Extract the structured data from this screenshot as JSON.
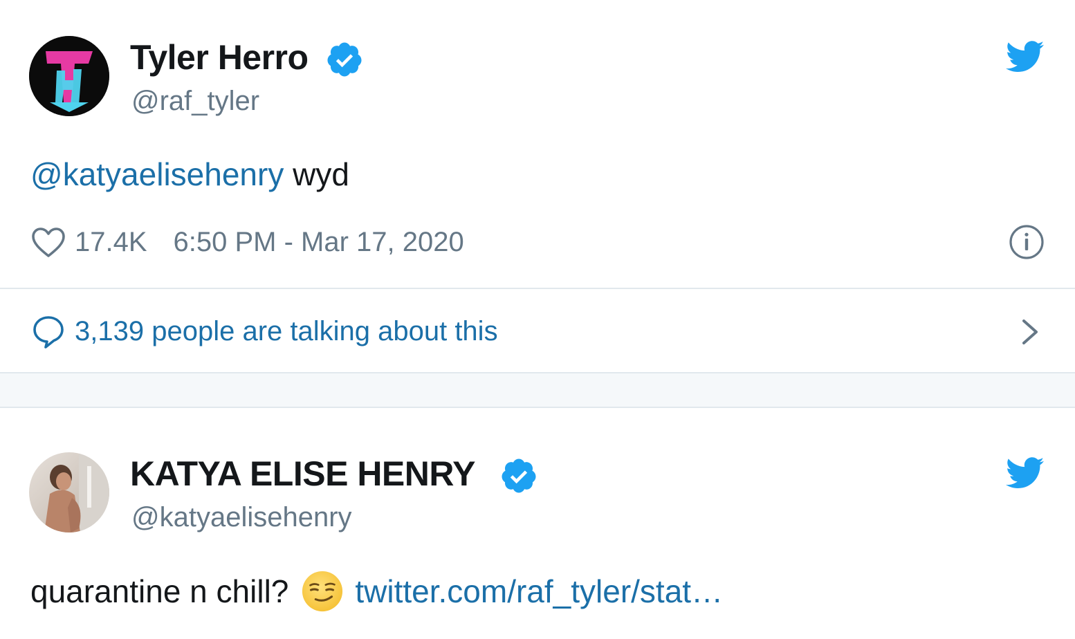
{
  "colors": {
    "accent": "#1da1f2",
    "link": "#1b6fa8",
    "text": "#14171a",
    "secondary": "#657786",
    "divider": "#e1e8ed"
  },
  "tweets": [
    {
      "avatar": "tyler-herro-logo-avatar",
      "display_name": "Tyler Herro",
      "verified": true,
      "handle": "@raf_tyler",
      "mention": "@katyaelisehenry",
      "text": " wyd",
      "likes": "17.4K",
      "timestamp": "6:50 PM - Mar 17, 2020",
      "conversation": "3,139 people are talking about this"
    },
    {
      "avatar": "katya-photo-avatar",
      "display_name": "KATYA ELISE HENRY",
      "verified": true,
      "handle": "@katyaelisehenry",
      "text": "quarantine n chill?",
      "emoji": "smirking-face",
      "link": "twitter.com/raf_tyler/stat…"
    }
  ]
}
